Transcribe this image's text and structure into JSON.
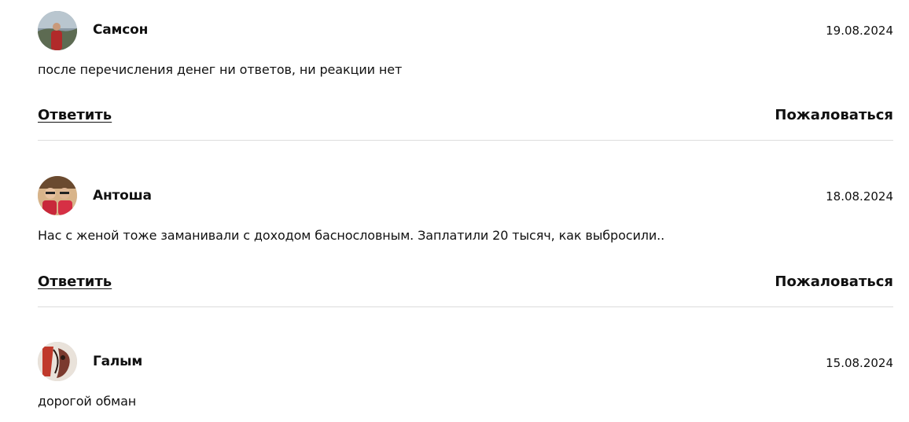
{
  "comments": [
    {
      "author": "Самсон",
      "date": "19.08.2024",
      "text": "после перечисления денег ни ответов, ни реакции нет",
      "reply_label": "Ответить",
      "report_label": "Пожаловаться"
    },
    {
      "author": "Антоша",
      "date": "18.08.2024",
      "text": "Нас с женой тоже заманивали с доходом баснословным. Заплатили 20 тысяч, как выбросили..",
      "reply_label": "Ответить",
      "report_label": "Пожаловаться"
    },
    {
      "author": "Галым",
      "date": "15.08.2024",
      "text": "дорогой обман"
    }
  ]
}
